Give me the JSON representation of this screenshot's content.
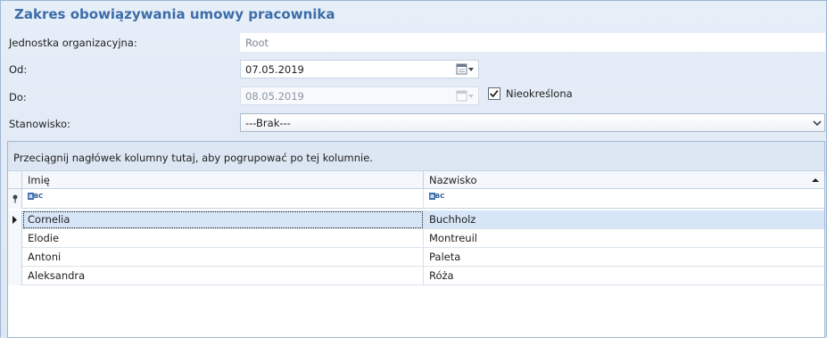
{
  "title": "Zakres obowiązywania umowy pracownika",
  "form": {
    "unit_label": "Jednostka organizacyjna:",
    "unit_value": "Root",
    "from_label": "Od:",
    "from_value": "07.05.2019",
    "to_label": "Do:",
    "to_value": "08.05.2019",
    "indefinite_label": "Nieokreślona",
    "position_label": "Stanowisko:",
    "position_value": "---Brak---"
  },
  "grid": {
    "group_hint": "Przeciągnij nagłówek kolumny tutaj, aby pogrupować po tej kolumnie.",
    "columns": [
      "Imię",
      "Nazwisko"
    ],
    "rows": [
      [
        "Cornelia",
        "Buchholz"
      ],
      [
        "Elodie",
        "Montreuil"
      ],
      [
        "Antoni",
        "Paleta"
      ],
      [
        "Aleksandra",
        "Róża"
      ]
    ]
  },
  "colors": {
    "title": "#3d6da8",
    "panel": "#dfe9f5",
    "selected_row": "#d7e6f7"
  },
  "icons": [
    "calendar-icon",
    "dropdown-arrow-icon",
    "checkmark-icon",
    "sort-asc-icon",
    "filter-pin-icon",
    "row-pointer-icon"
  ]
}
